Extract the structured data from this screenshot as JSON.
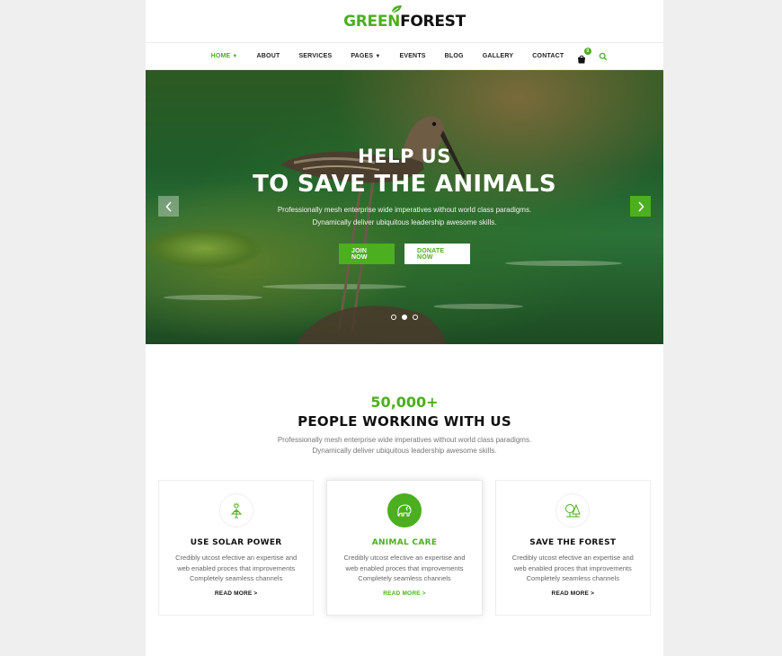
{
  "logo": {
    "green": "GREEN",
    "dark": "FOREST"
  },
  "nav": {
    "items": [
      {
        "label": "HOME",
        "active": true,
        "dropdown": true
      },
      {
        "label": "ABOUT"
      },
      {
        "label": "SERVICES"
      },
      {
        "label": "PAGES",
        "dropdown": true
      },
      {
        "label": "EVENTS"
      },
      {
        "label": "BLOG"
      },
      {
        "label": "GALLERY"
      },
      {
        "label": "CONTACT"
      }
    ],
    "cart_count": "0"
  },
  "hero": {
    "title_small": "HELP US",
    "title_large": "TO SAVE THE ANIMALS",
    "subtitle_line1": "Professionally mesh enterprise wide imperatives without world class paradigms.",
    "subtitle_line2": "Dynamically deliver ubiquitous leadership awesome skills.",
    "join_label": "JOIN NOW",
    "donate_label": "DONATE NOW",
    "active_slide": 2,
    "slide_count": 3
  },
  "stats": {
    "number": "50,000+",
    "title": "PEOPLE WORKING WITH US",
    "desc_line1": "Professionally mesh enterprise wide imperatives without world class paradigms.",
    "desc_line2": "Dynamically deliver ubiquitous leadership awesome skills."
  },
  "features": [
    {
      "icon": "solar-panel-icon",
      "title": "USE SOLAR POWER",
      "line1": "Credibly utcost efective an expertise and",
      "line2": "web enabled proces that improvements",
      "line3": "Completely seamless channels",
      "link": "READ MORE >"
    },
    {
      "icon": "elephant-icon",
      "title": "ANIMAL CARE",
      "line1": "Credibly utcost efective an expertise and",
      "line2": "web enabled proces that improvements",
      "line3": "Completely seamless channels",
      "link": "READ MORE >"
    },
    {
      "icon": "trees-icon",
      "title": "SAVE THE FOREST",
      "line1": "Credibly utcost efective an expertise and",
      "line2": "web enabled proces that improvements",
      "line3": "Completely seamless channels",
      "link": "READ MORE >"
    }
  ],
  "colors": {
    "accent": "#4caf1f",
    "text_dark": "#111111",
    "text_muted": "#777777"
  }
}
